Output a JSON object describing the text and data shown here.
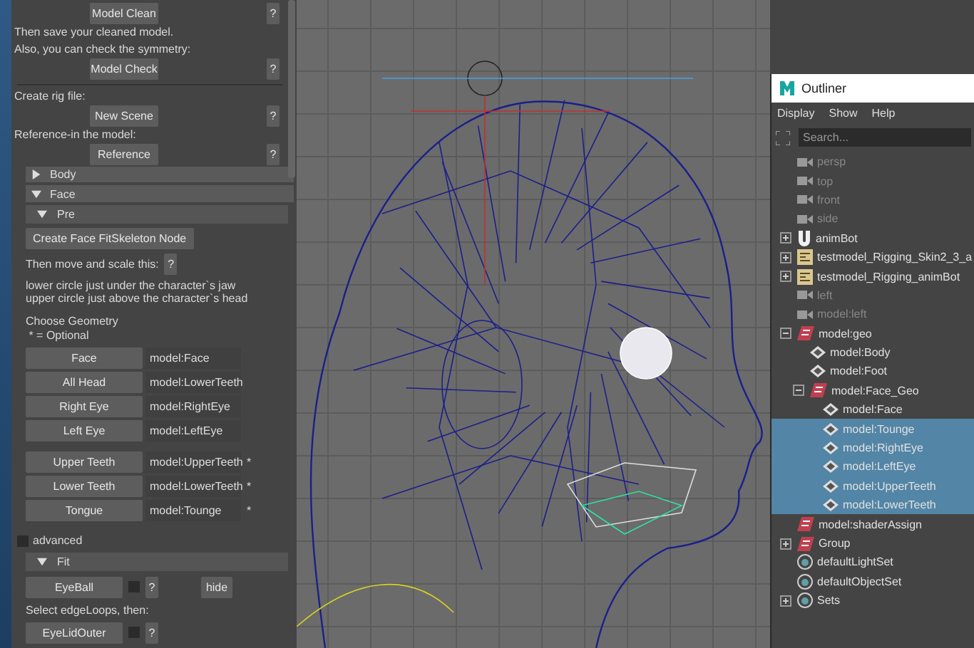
{
  "rig_panel": {
    "setup": [
      {
        "kind": "action",
        "label": "Model Clean",
        "help": "?"
      },
      {
        "kind": "note",
        "text": "Then save your cleaned model."
      },
      {
        "kind": "note",
        "text": "Also, you can check the symmetry:"
      },
      {
        "kind": "action",
        "label": "Model Check",
        "help": "?"
      },
      {
        "kind": "rule"
      },
      {
        "kind": "note",
        "text": "Create rig file:"
      },
      {
        "kind": "action",
        "label": "New Scene",
        "help": "?"
      },
      {
        "kind": "note",
        "text": "Reference-in the model:"
      },
      {
        "kind": "action",
        "label": "Reference",
        "help": "?"
      }
    ],
    "body_section": {
      "label": "Body",
      "expanded": false
    },
    "face_section": {
      "label": "Face",
      "expanded": true,
      "pre": {
        "label": "Pre",
        "expanded": true,
        "create_button": "Create Face FitSkeleton Node",
        "move_text": "Then move and scale this:",
        "move_help": "?",
        "instructions": [
          "lower circle just under the character`s jaw",
          "upper circle just above the character`s head"
        ],
        "geometry_heading": "Choose Geometry",
        "geometry_note": " * = Optional",
        "geometry_groups": [
          {
            "rows": [
              {
                "button": "Face",
                "value": "model:Face",
                "optional": false
              },
              {
                "button": "All Head",
                "value": "model:LowerTeeth",
                "optional": false
              },
              {
                "button": "Right Eye",
                "value": "model:RightEye",
                "optional": false
              },
              {
                "button": "Left Eye",
                "value": "model:LeftEye",
                "optional": false
              }
            ]
          },
          {
            "rows": [
              {
                "button": "Upper Teeth",
                "value": "model:UpperTeeth",
                "optional": true,
                "mark": "*"
              },
              {
                "button": "Lower Teeth",
                "value": "model:LowerTeeth",
                "optional": true,
                "mark": "*"
              },
              {
                "button": "Tongue",
                "value": "model:Tounge",
                "optional": true,
                "mark": "*"
              }
            ]
          }
        ]
      },
      "advanced": {
        "label": "advanced",
        "checked": false
      },
      "fit": {
        "label": "Fit",
        "expanded": true,
        "eyeball": {
          "label": "EyeBall",
          "checked": false,
          "help": "?",
          "hide": "hide"
        },
        "edge_text": "Select edgeLoops, then:",
        "eyelid": {
          "label": "EyeLidOuter",
          "checked": false,
          "help": "?"
        }
      }
    }
  },
  "outliner": {
    "title": "Outliner",
    "menu": [
      "Display",
      "Show",
      "Help"
    ],
    "search": {
      "placeholder": "Search..."
    },
    "items": [
      {
        "name": "persp",
        "kind": "camera",
        "hidden": true,
        "selected": false,
        "expandable": false
      },
      {
        "name": "top",
        "kind": "camera",
        "hidden": true,
        "selected": false,
        "expandable": false
      },
      {
        "name": "front",
        "kind": "camera",
        "hidden": true,
        "selected": false,
        "expandable": false
      },
      {
        "name": "side",
        "kind": "camera",
        "hidden": true,
        "selected": false,
        "expandable": false
      },
      {
        "name": "animBot",
        "kind": "rig",
        "hidden": false,
        "selected": false,
        "expandable": true,
        "expanded": false
      },
      {
        "name": "testmodel_Rigging_Skin2_3_a",
        "kind": "reference",
        "hidden": false,
        "selected": false,
        "expandable": true,
        "expanded": false
      },
      {
        "name": "testmodel_Rigging_animBot",
        "kind": "reference",
        "hidden": false,
        "selected": false,
        "expandable": true,
        "expanded": false
      },
      {
        "name": "left",
        "kind": "camera",
        "hidden": true,
        "selected": false,
        "expandable": false
      },
      {
        "name": "model:left",
        "kind": "camera",
        "hidden": true,
        "selected": false,
        "expandable": false
      },
      {
        "name": "model:geo",
        "kind": "group",
        "hidden": false,
        "selected": false,
        "expandable": true,
        "expanded": true,
        "children": [
          {
            "name": "model:Body",
            "kind": "mesh",
            "hidden": false,
            "selected": false,
            "expandable": false
          },
          {
            "name": "model:Foot",
            "kind": "mesh",
            "hidden": false,
            "selected": false,
            "expandable": false
          },
          {
            "name": "model:Face_Geo",
            "kind": "group",
            "hidden": false,
            "selected": false,
            "expandable": true,
            "expanded": true,
            "children": [
              {
                "name": "model:Face",
                "kind": "mesh",
                "hidden": false,
                "selected": false,
                "expandable": false
              },
              {
                "name": "model:Tounge",
                "kind": "mesh",
                "hidden": false,
                "selected": true,
                "expandable": false
              },
              {
                "name": "model:RightEye",
                "kind": "mesh",
                "hidden": false,
                "selected": true,
                "expandable": false
              },
              {
                "name": "model:LeftEye",
                "kind": "mesh",
                "hidden": false,
                "selected": true,
                "expandable": false
              },
              {
                "name": "model:UpperTeeth",
                "kind": "mesh",
                "hidden": false,
                "selected": true,
                "expandable": false
              },
              {
                "name": "model:LowerTeeth",
                "kind": "mesh",
                "hidden": false,
                "selected": true,
                "expandable": false
              }
            ]
          }
        ]
      },
      {
        "name": "model:shaderAssign",
        "kind": "group",
        "hidden": false,
        "selected": false,
        "expandable": false
      },
      {
        "name": "Group",
        "kind": "group",
        "hidden": false,
        "selected": false,
        "expandable": true,
        "expanded": false
      },
      {
        "name": "defaultLightSet",
        "kind": "set",
        "hidden": false,
        "selected": false,
        "expandable": false
      },
      {
        "name": "defaultObjectSet",
        "kind": "set",
        "hidden": false,
        "selected": false,
        "expandable": false
      },
      {
        "name": "Sets",
        "kind": "set",
        "hidden": false,
        "selected": false,
        "expandable": true,
        "expanded": false
      }
    ]
  }
}
